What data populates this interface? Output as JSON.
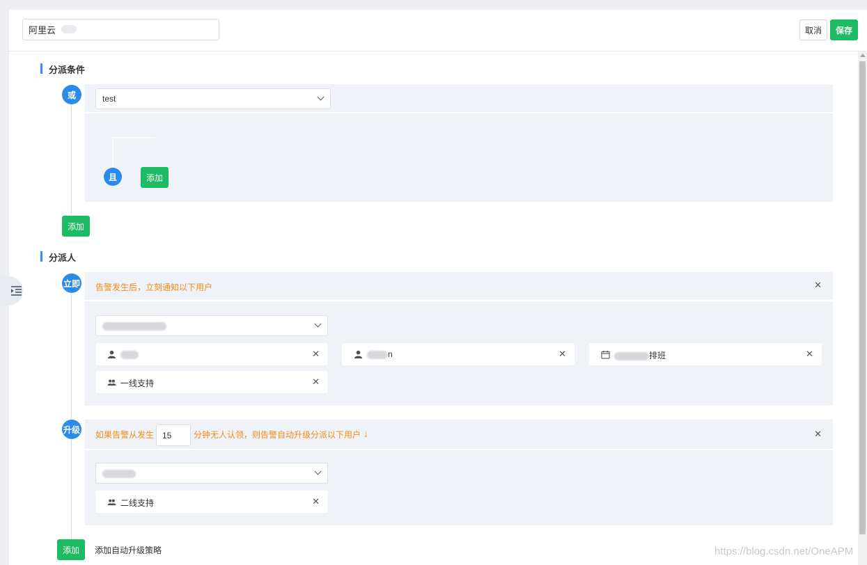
{
  "header": {
    "name_value": "阿里云",
    "cancel_label": "取消",
    "save_label": "保存"
  },
  "conditions": {
    "title": "分派条件",
    "or_label": "或",
    "select_value": "test",
    "and_label": "且",
    "inner_add_label": "添加",
    "add_label": "添加"
  },
  "assignees": {
    "title": "分派人",
    "immediate": {
      "label": "立即",
      "hint": "告警发生后，立刻通知以下用户",
      "chips": [
        {
          "icon": "user-icon",
          "text": ""
        },
        {
          "icon": "user-icon",
          "text": "n"
        },
        {
          "icon": "calendar-icon",
          "text": "排班"
        },
        {
          "icon": "group-icon",
          "text": "一线支持"
        }
      ]
    },
    "escalate": {
      "label": "升级",
      "hint_prefix": "如果告警从发生",
      "minutes": "15",
      "hint_suffix": "分钟无人认领，则告警自动升级分派以下用户",
      "chips": [
        {
          "icon": "group-icon",
          "text": "二线支持"
        }
      ]
    },
    "add_label": "添加",
    "add_strategy_label": "添加自动升级策略"
  },
  "watermark": "https://blog.csdn.net/OneAPM",
  "colors": {
    "accent": "#2b8bea",
    "primary_button": "#1dbc64",
    "warning_text": "#f08c19",
    "panel_bg": "#eff2f6"
  }
}
